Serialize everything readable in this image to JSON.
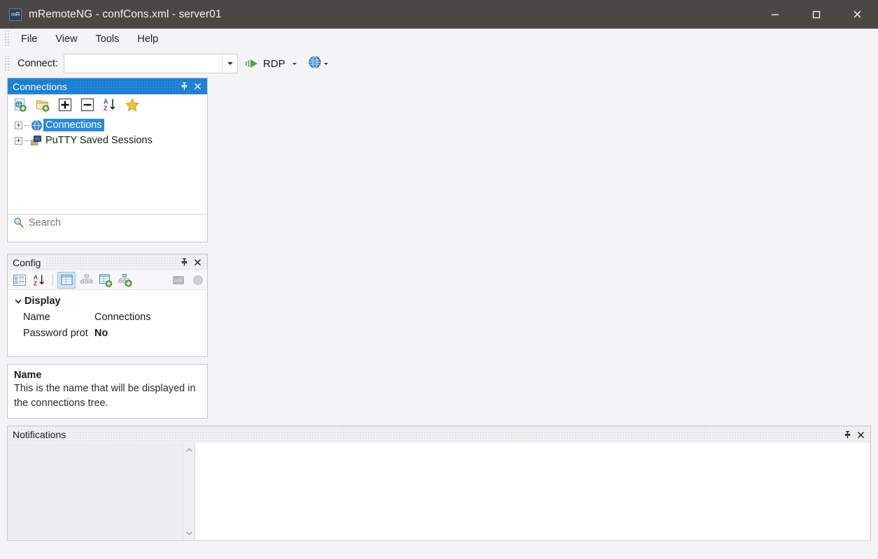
{
  "window": {
    "title": "mRemoteNG - confCons.xml - server01",
    "app_icon": "mremoteng-icon",
    "icon_text": "mR",
    "minimize_label": "Minimize",
    "maximize_label": "Maximize",
    "close_label": "Close"
  },
  "menubar": {
    "items": [
      {
        "label": "File"
      },
      {
        "label": "View"
      },
      {
        "label": "Tools"
      },
      {
        "label": "Help"
      }
    ]
  },
  "toolbar": {
    "connect_label": "Connect:",
    "connect_value": "",
    "connect_placeholder": "",
    "protocol_label": "RDP",
    "quick_connect_icon": "connect-play-icon",
    "protocol_dropdown_icon": "chevron-down-icon",
    "globe_icon": "globe-icon",
    "globe_dropdown_icon": "chevron-down-icon"
  },
  "connections_panel": {
    "title": "Connections",
    "active": true,
    "pin_label": "Auto Hide",
    "close_label": "Close",
    "toolbar": [
      {
        "name": "new-connection-icon",
        "tooltip": "New Connection"
      },
      {
        "name": "new-folder-icon",
        "tooltip": "New Folder"
      },
      {
        "name": "expand-all-icon",
        "tooltip": "Expand All"
      },
      {
        "name": "collapse-all-icon",
        "tooltip": "Collapse All"
      },
      {
        "name": "sort-az-icon",
        "tooltip": "Sort A-Z"
      },
      {
        "name": "favorites-star-icon",
        "tooltip": "Favorites"
      }
    ],
    "tree": [
      {
        "label": "Connections",
        "icon": "globe-icon",
        "selected": true,
        "expander": "+"
      },
      {
        "label": "PuTTY Saved Sessions",
        "icon": "putty-icon",
        "selected": false,
        "expander": "+"
      }
    ],
    "search_placeholder": "Search",
    "search_value": "",
    "search_icon": "search-icon"
  },
  "config_panel": {
    "title": "Config",
    "active": false,
    "pin_label": "Auto Hide",
    "close_label": "Close",
    "toolbar": [
      {
        "name": "categorized-view-icon",
        "selected": false
      },
      {
        "name": "sort-alphabetical-icon",
        "selected": false
      },
      {
        "name": "property-grid-icon",
        "selected": true
      },
      {
        "name": "inheritance-icon",
        "selected": false
      },
      {
        "name": "default-properties-icon",
        "selected": false
      },
      {
        "name": "default-inheritance-icon",
        "selected": false
      },
      {
        "name": "mremoteng-badge-icon",
        "selected": false
      },
      {
        "name": "status-circle-icon",
        "selected": false
      }
    ],
    "category": "Display",
    "category_expanded": true,
    "properties": [
      {
        "key": "Name",
        "value": "Connections",
        "bold": false
      },
      {
        "key": "Password prot",
        "value": "No",
        "bold": true
      }
    ]
  },
  "description_panel": {
    "title": "Name",
    "text": "This is the name that will be displayed in the connections tree."
  },
  "notifications_panel": {
    "title": "Notifications",
    "pin_label": "Auto Hide",
    "close_label": "Close",
    "messages": [],
    "scroll_up_icon": "chevron-up-icon",
    "scroll_down_icon": "chevron-down-icon"
  },
  "colors": {
    "titlebar": "#4a4845",
    "accent_blue": "#1b7fd4",
    "selection_blue": "#2a8ae0",
    "window_bg": "#f4f3f6",
    "panel_bg": "#ffffff",
    "border": "#c6c6cc"
  }
}
